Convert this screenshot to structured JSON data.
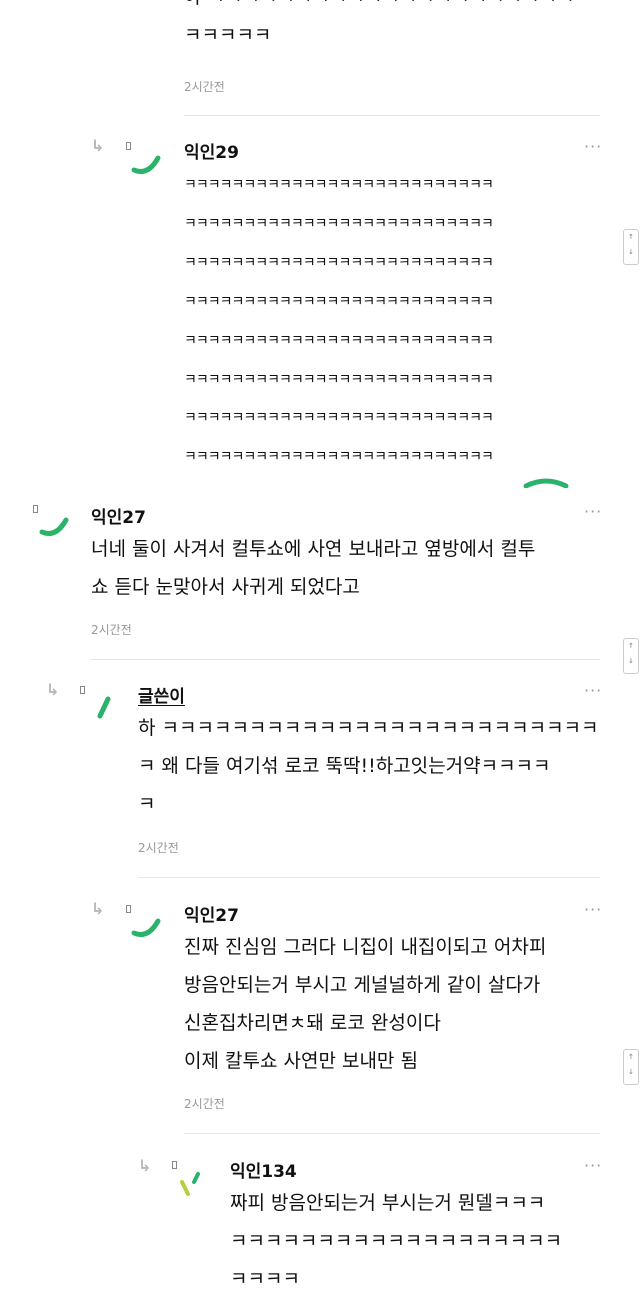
{
  "colors": {
    "green": "#2bb36b",
    "lime": "#b7cf3a",
    "time": "#999999"
  },
  "comments": [
    {
      "id": "c0",
      "body_tail": "아 ㅋㅋㅋㅋㅋㅋㅋㅋㅋㅋㅋㅋㅋㅋㅋㅋㅋㅋㅋㅋㅋ\nㅋㅋㅋㅋㅋ",
      "time": "2시간전",
      "more": "···"
    },
    {
      "id": "c1",
      "nick": "익인29",
      "body": "ㅋㅋㅋㅋㅋㅋㅋㅋㅋㅋㅋㅋㅋㅋㅋㅋㅋㅋㅋㅋㅋㅋㅋㅋㅋㅋ\nㅋㅋㅋㅋㅋㅋㅋㅋㅋㅋㅋㅋㅋㅋㅋㅋㅋㅋㅋㅋㅋㅋㅋㅋㅋㅋ\nㅋㅋㅋㅋㅋㅋㅋㅋㅋㅋㅋㅋㅋㅋㅋㅋㅋㅋㅋㅋㅋㅋㅋㅋㅋㅋ\nㅋㅋㅋㅋㅋㅋㅋㅋㅋㅋㅋㅋㅋㅋㅋㅋㅋㅋㅋㅋㅋㅋㅋㅋㅋㅋ\nㅋㅋㅋㅋㅋㅋㅋㅋㅋㅋㅋㅋㅋㅋㅋㅋㅋㅋㅋㅋㅋㅋㅋㅋㅋㅋ\nㅋㅋㅋㅋㅋㅋㅋㅋㅋㅋㅋㅋㅋㅋㅋㅋㅋㅋㅋㅋㅋㅋㅋㅋㅋㅋ\nㅋㅋㅋㅋㅋㅋㅋㅋㅋㅋㅋㅋㅋㅋㅋㅋㅋㅋㅋㅋㅋㅋㅋㅋㅋㅋ\nㅋㅋㅋㅋㅋㅋㅋㅋㅋㅋㅋㅋㅋㅋㅋㅋㅋㅋㅋㅋㅋㅋㅋㅋㅋㅋ",
      "more": "···"
    },
    {
      "id": "c2",
      "nick": "익인27",
      "body": "너네 둘이 사겨서 컬투쇼에 사연 보내라고 옆방에서 컬투\n쇼 듣다 눈맞아서 사귀게 되었다고",
      "time": "2시간전",
      "more": "···"
    },
    {
      "id": "c3",
      "nick": "글쓴이",
      "body": "하 ㅋㅋㅋㅋㅋㅋㅋㅋㅋㅋㅋㅋㅋㅋㅋㅋㅋㅋㅋㅋㅋㅋㅋㅋㅋ\nㅋ 왜 다들 여기섞 로코 뚝딱!!하고잇는거약ㅋㅋㅋㅋ\nㅋ",
      "time": "2시간전",
      "more": "···"
    },
    {
      "id": "c4",
      "nick": "익인27",
      "body": "진짜 진심임 그러다 니집이 내집이되고 어차피\n방음안되는거 부시고 게널널하게 같이 살다가\n신혼집차리면ㅊ돼 로코 완성이다\n이제 칼투쇼 사연만 보내만 됨",
      "time": "2시간전",
      "more": "···"
    },
    {
      "id": "c5",
      "nick": "익인134",
      "body": "짜피 방음안되는거 부시는거 뭔델ㅋㅋㅋ\nㅋㅋㅋㅋㅋㅋㅋㅋㅋㅋㅋㅋㅋㅋㅋㅋㅋㅋㅋ\nㅋㅋㅋㅋ",
      "more": "···"
    }
  ],
  "scroll_buttons": {
    "up": "↑",
    "down": "↓"
  },
  "icons": {
    "reply": "reply-arrow-icon",
    "more": "more-options-icon"
  }
}
